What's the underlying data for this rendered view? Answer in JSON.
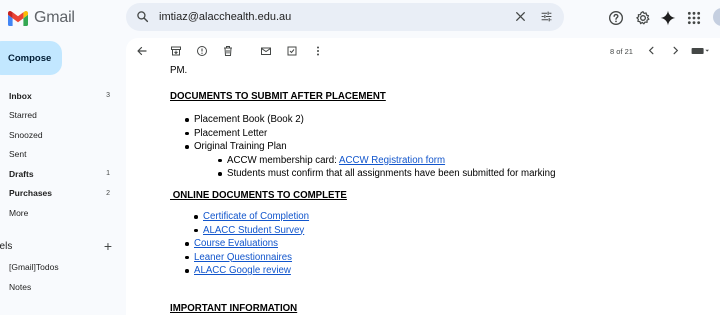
{
  "app": {
    "name": "Gmail"
  },
  "search": {
    "value": "imtiaz@alacchealth.edu.au"
  },
  "compose": {
    "label": "Compose"
  },
  "nav": [
    {
      "label": "Inbox",
      "count": "3",
      "bold": true
    },
    {
      "label": "Starred",
      "count": ""
    },
    {
      "label": "Snoozed",
      "count": ""
    },
    {
      "label": "Sent",
      "count": ""
    },
    {
      "label": "Drafts",
      "count": "1",
      "bold": true
    },
    {
      "label": "Purchases",
      "count": "2",
      "bold": true
    },
    {
      "label": "More",
      "count": ""
    }
  ],
  "labels": {
    "heading": "bels",
    "items": [
      "[Gmail]Todos",
      "Notes"
    ]
  },
  "toolbar": {
    "pager": "8 of 21"
  },
  "email": {
    "pm": "PM.",
    "docs_after_heading": "DOCUMENTS TO SUBMIT AFTER PLACEMENT",
    "docs_after": [
      "Placement Book (Book 2)",
      "Placement Letter",
      "Original Training Plan"
    ],
    "sub_acc_prefix": "ACCW membership card: ",
    "sub_acc_link": "ACCW Registration form",
    "sub_confirm": "Students must confirm that all assignments have been submitted for marking",
    "online_heading": " ONLINE DOCUMENTS TO COMPLETE",
    "online_sub_links": [
      "Certificate of Completion",
      "ALACC Student Survey"
    ],
    "online_links": [
      "Course Evaluations",
      "Leaner Questionnaires",
      "ALACC Google review"
    ],
    "next_heading": "IMPORTANT INFORMATION"
  },
  "colors": {
    "compose_bg": "#c2e7ff",
    "link": "#1155cc",
    "search_bg": "#e9eef6",
    "page_bg": "#f8fafd"
  }
}
